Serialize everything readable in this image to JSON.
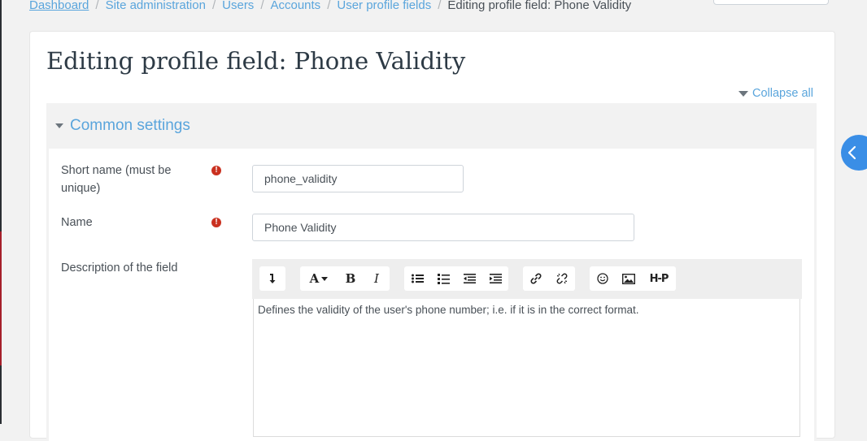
{
  "breadcrumb": {
    "items": [
      "Dashboard",
      "Site administration",
      "Users",
      "Accounts",
      "User profile fields"
    ],
    "current": "Editing profile field: Phone Validity",
    "separator": "/"
  },
  "page": {
    "title": "Editing profile field: Phone Validity",
    "collapse_all": "Collapse all"
  },
  "section": {
    "legend": "Common settings"
  },
  "form": {
    "shortname_label": "Short name (must be unique)",
    "shortname_value": "phone_validity",
    "name_label": "Name",
    "name_value": "Phone Validity",
    "required_icon": "!",
    "description_label": "Description of the field",
    "description_text": "Defines the validity of the user's phone number; i.e. if it is in the correct format."
  },
  "toolbar": {
    "bold": "B",
    "italic": "I",
    "font_color": "A",
    "h5p": "H-P"
  },
  "colors": {
    "link": "#5aa5dc",
    "required": "#ca3120",
    "drawer": "#3a8ee6"
  }
}
